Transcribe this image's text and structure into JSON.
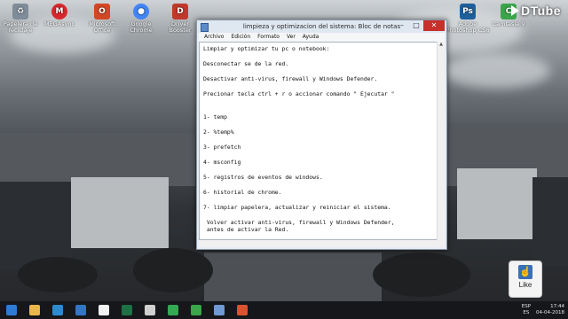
{
  "desktop": {
    "icons": [
      {
        "label": "Papelera de reciclaje",
        "icon": "recycle-bin-icon",
        "color": "#7f8c99"
      },
      {
        "label": "MEGAsync",
        "icon": "mega-icon",
        "color": "#d9272e"
      },
      {
        "label": "Microsoft Office",
        "icon": "office-icon",
        "color": "#d24726"
      },
      {
        "label": "Google Chrome",
        "icon": "chrome-icon",
        "color": "#4285f4"
      },
      {
        "label": "Driver Booster",
        "icon": "driver-booster-icon",
        "color": "#c0392b"
      }
    ],
    "right_icons": [
      {
        "label": "Adobe Photoshop CS6",
        "icon": "photoshop-icon",
        "color": "#1f5f9c"
      },
      {
        "label": "Camtasia 9",
        "icon": "camtasia-icon",
        "color": "#3aa54a"
      }
    ],
    "watermark": "DTube"
  },
  "notepad": {
    "title": "limpieza y optimizacion del sistema: Bloc de notas",
    "menu": [
      "Archivo",
      "Edición",
      "Formato",
      "Ver",
      "Ayuda"
    ],
    "lines": [
      "Limpiar y optimizar tu pc o notebook:",
      "",
      "Desconectar se de la red.",
      "",
      "Desactivar anti-virus, firewall y Windows Defender.",
      "",
      "Precionar tecla ctrl + r o accionar comando \" Ejecutar \"",
      "",
      "",
      "1- temp",
      "",
      "2- %temp%",
      "",
      "3- prefetch",
      "",
      "4- msconfig",
      "",
      "5- registros de eventos de windows.",
      "",
      "6- historial de chrome.",
      "",
      "7- limpiar papelera, actualizar y reiniciar el sistema.",
      "",
      " Volver activar anti-virus, firewall y Windows Defender,",
      " antes de activar la Red."
    ]
  },
  "like_button": {
    "label": "Like"
  },
  "taskbar": {
    "items": [
      {
        "icon": "windows-start-icon",
        "color": "#2e7bd6"
      },
      {
        "icon": "explorer-icon",
        "color": "#e8b64a"
      },
      {
        "icon": "store-icon",
        "color": "#2b8ad1"
      },
      {
        "icon": "maxthon-icon",
        "color": "#3574c6"
      },
      {
        "icon": "home-icon",
        "color": "#f2f2f2"
      },
      {
        "icon": "excel-icon",
        "color": "#1e7145"
      },
      {
        "icon": "media-icon",
        "color": "#d0d0d0"
      },
      {
        "icon": "chrome-icon",
        "color": "#34a853"
      },
      {
        "icon": "camtasia-icon",
        "color": "#3aa54a"
      },
      {
        "icon": "notepad-icon",
        "color": "#6f9ad4"
      },
      {
        "icon": "camtasia-recorder-icon",
        "color": "#d9532f"
      }
    ],
    "language": {
      "code": "ESP",
      "layout": "ES"
    },
    "clock": {
      "time": "17:44",
      "date": "04-04-2018"
    }
  }
}
